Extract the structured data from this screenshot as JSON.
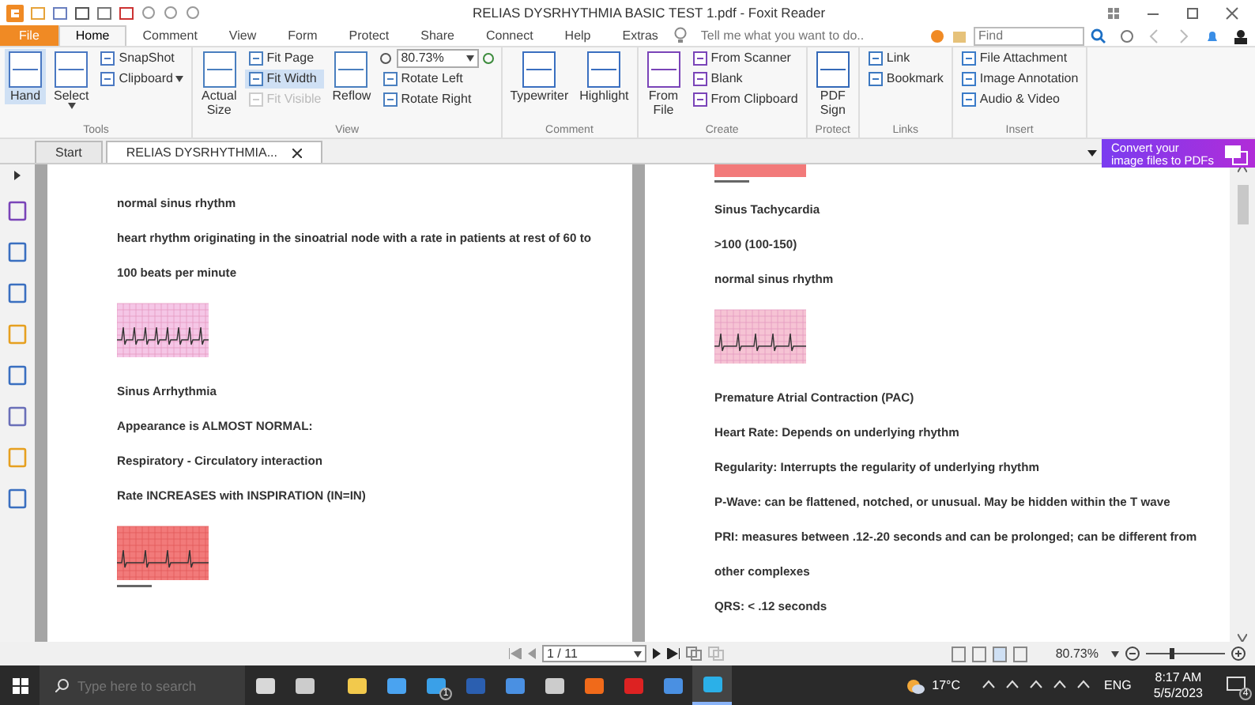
{
  "window": {
    "title": "RELIAS DYSRHYTHMIA BASIC TEST 1.pdf - Foxit Reader"
  },
  "ribbon_tabs": [
    {
      "label": "File",
      "selected": false,
      "kind": "file"
    },
    {
      "label": "Home",
      "selected": true,
      "kind": "tab"
    },
    {
      "label": "Comment",
      "selected": false,
      "kind": "tab"
    },
    {
      "label": "View",
      "selected": false,
      "kind": "tab"
    },
    {
      "label": "Form",
      "selected": false,
      "kind": "tab"
    },
    {
      "label": "Protect",
      "selected": false,
      "kind": "tab"
    },
    {
      "label": "Share",
      "selected": false,
      "kind": "tab"
    },
    {
      "label": "Connect",
      "selected": false,
      "kind": "tab"
    },
    {
      "label": "Help",
      "selected": false,
      "kind": "tab"
    },
    {
      "label": "Extras",
      "selected": false,
      "kind": "tab"
    }
  ],
  "tell_me": {
    "placeholder": "Tell me what you want to do.."
  },
  "find": {
    "placeholder": "Find"
  },
  "ribbon_groups": [
    {
      "label": "Tools",
      "columns": [
        [
          {
            "kind": "large",
            "label": "Hand",
            "selected": true,
            "disabled": false
          }
        ],
        [
          {
            "kind": "large",
            "label": "Select",
            "selected": false,
            "disabled": false,
            "dropdown": true
          }
        ],
        [
          {
            "kind": "small",
            "label": "SnapShot",
            "selected": false,
            "disabled": false
          },
          {
            "kind": "small",
            "label": "Clipboard",
            "selected": false,
            "disabled": false,
            "dropdown": true
          }
        ]
      ]
    },
    {
      "label": "View",
      "columns": [
        [
          {
            "kind": "large",
            "label": "Actual Size",
            "selected": false,
            "disabled": false
          }
        ],
        [
          {
            "kind": "small",
            "label": "Fit Page",
            "selected": false,
            "disabled": false
          },
          {
            "kind": "small",
            "label": "Fit Width",
            "selected": true,
            "disabled": false
          },
          {
            "kind": "small",
            "label": "Fit Visible",
            "selected": false,
            "disabled": true
          }
        ],
        [
          {
            "kind": "large",
            "label": "Reflow",
            "selected": false,
            "disabled": false
          }
        ],
        [
          {
            "kind": "zoom",
            "value": "80.73%"
          },
          {
            "kind": "small",
            "label": "Rotate Left",
            "selected": false,
            "disabled": false
          },
          {
            "kind": "small",
            "label": "Rotate Right",
            "selected": false,
            "disabled": false
          }
        ]
      ]
    },
    {
      "label": "Comment",
      "columns": [
        [
          {
            "kind": "large",
            "label": "Typewriter",
            "selected": false,
            "disabled": false
          }
        ],
        [
          {
            "kind": "large",
            "label": "Highlight",
            "selected": false,
            "disabled": false
          }
        ]
      ]
    },
    {
      "label": "Create",
      "columns": [
        [
          {
            "kind": "large",
            "label": "From File",
            "selected": false,
            "disabled": false
          }
        ],
        [
          {
            "kind": "small",
            "label": "From Scanner",
            "selected": false,
            "disabled": false
          },
          {
            "kind": "small",
            "label": "Blank",
            "selected": false,
            "disabled": false
          },
          {
            "kind": "small",
            "label": "From Clipboard",
            "selected": false,
            "disabled": false
          }
        ]
      ]
    },
    {
      "label": "Protect",
      "columns": [
        [
          {
            "kind": "large",
            "label": "PDF Sign",
            "selected": false,
            "disabled": false
          }
        ]
      ]
    },
    {
      "label": "Links",
      "columns": [
        [
          {
            "kind": "small",
            "label": "Link",
            "selected": false,
            "disabled": false
          },
          {
            "kind": "small",
            "label": "Bookmark",
            "selected": false,
            "disabled": false
          }
        ]
      ]
    },
    {
      "label": "Insert",
      "columns": [
        [
          {
            "kind": "small",
            "label": "File Attachment",
            "selected": false,
            "disabled": false
          },
          {
            "kind": "small",
            "label": "Image Annotation",
            "selected": false,
            "disabled": false
          },
          {
            "kind": "small",
            "label": "Audio & Video",
            "selected": false,
            "disabled": false
          }
        ]
      ]
    }
  ],
  "doc_tabs": [
    {
      "label": "Start",
      "selected": false
    },
    {
      "label": "RELIAS DYSRHYTHMIA...",
      "selected": true
    }
  ],
  "promo": {
    "lines": [
      "Convert your",
      "image files to PDFs"
    ]
  },
  "pages": [
    {
      "items": [
        {
          "kind": "text",
          "text": "normal sinus rhythm"
        },
        {
          "kind": "text",
          "text": "heart rhythm originating in the sinoatrial node with a rate in patients at rest of 60 to 100 beats per minute"
        },
        {
          "kind": "pinkstrip"
        },
        {
          "kind": "text",
          "text": "Sinus Arrhythmia"
        },
        {
          "kind": "text",
          "text": "Appearance is ALMOST NORMAL:"
        },
        {
          "kind": "text",
          "text": "Respiratory - Circulatory interaction"
        },
        {
          "kind": "text",
          "text": "Rate INCREASES with INSPIRATION (IN=IN)"
        },
        {
          "kind": "redstrip"
        }
      ]
    },
    {
      "items": [
        {
          "kind": "stripend"
        },
        {
          "kind": "text",
          "text": "Sinus Tachycardia"
        },
        {
          "kind": "text",
          "text": ">100 (100-150)"
        },
        {
          "kind": "text",
          "text": "normal sinus rhythm"
        },
        {
          "kind": "tachystrip"
        },
        {
          "kind": "text",
          "text": "Premature Atrial Contraction (PAC)"
        },
        {
          "kind": "text",
          "text": "Heart Rate: Depends on underlying rhythm"
        },
        {
          "kind": "text",
          "text": "Regularity: Interrupts the regularity of underlying rhythm"
        },
        {
          "kind": "text",
          "text": "P-Wave: can be flattened, notched, or unusual. May be hidden within the T wave"
        },
        {
          "kind": "text",
          "text": "PRI: measures between .12-.20 seconds and can be prolonged; can be different from other complexes"
        },
        {
          "kind": "text",
          "text": "QRS: < .12 seconds"
        }
      ]
    }
  ],
  "status_bar": {
    "page": "1 / 11",
    "zoom": "80.73%",
    "zoom_slider": {
      "level": 0.3
    }
  },
  "taskbar": {
    "search": {
      "placeholder": "Type here to search"
    },
    "apps": [
      {
        "selected": false
      },
      {
        "selected": false
      },
      {
        "selected": false
      },
      {
        "selected": false
      },
      {
        "selected": false,
        "badge": "1"
      },
      {
        "selected": false
      },
      {
        "selected": false
      },
      {
        "selected": false
      },
      {
        "selected": false
      },
      {
        "selected": false
      },
      {
        "selected": false
      },
      {
        "selected": true
      }
    ],
    "weather": "17°C",
    "language": "ENG",
    "time": "8:17 AM",
    "date": "5/5/2023",
    "notifications": "4"
  }
}
